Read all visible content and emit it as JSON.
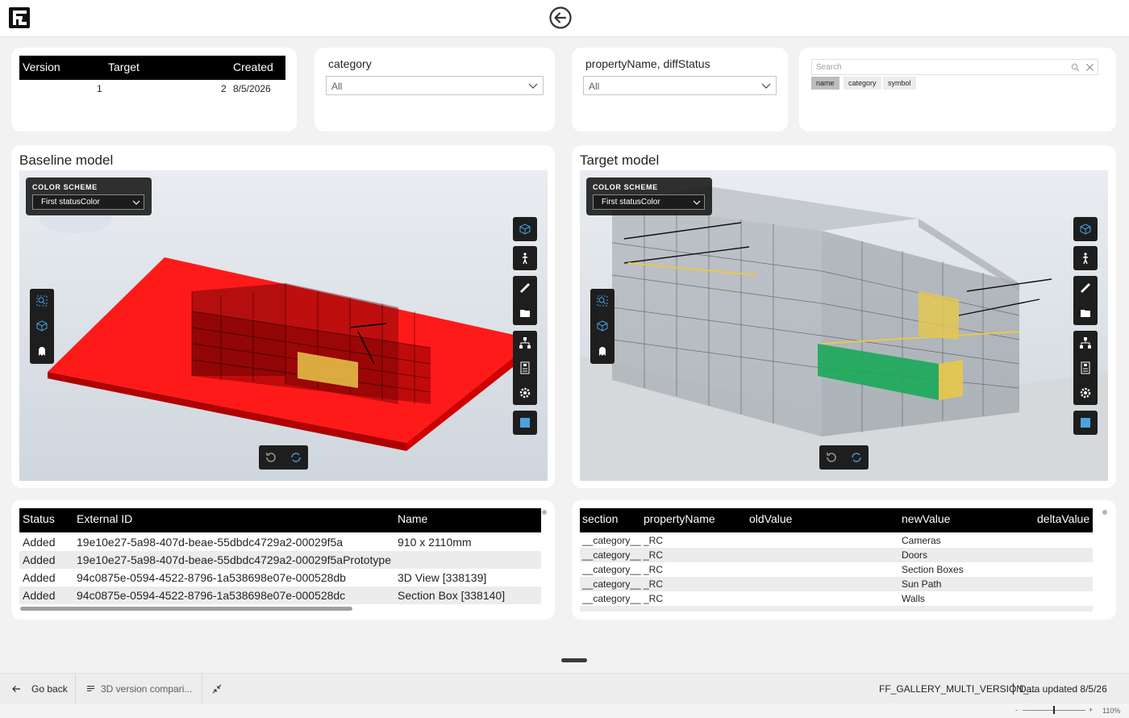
{
  "header": {
    "logo_icon": "flowfuse-logo",
    "back_icon": "circle-arrow-left-icon"
  },
  "version_table": {
    "columns": [
      "Version",
      "Target",
      "Created"
    ],
    "rows": [
      {
        "version": "1",
        "target": "2",
        "created": "8/5/2026"
      }
    ]
  },
  "category_slicer": {
    "title": "category",
    "value": "All"
  },
  "property_slicer": {
    "title": "propertyName, diffStatus",
    "value": "All"
  },
  "search_slicer": {
    "placeholder": "Search",
    "chips": [
      {
        "label": "name",
        "active": true
      },
      {
        "label": "category",
        "active": false
      },
      {
        "label": "symbol",
        "active": false
      }
    ]
  },
  "baseline": {
    "title": "Baseline model",
    "color_scheme_label": "COLOR SCHEME",
    "color_scheme_value": "First statusColor",
    "highlight_colors": {
      "added": "#ff1a1a",
      "modified": "#e8c84a"
    }
  },
  "target": {
    "title": "Target model",
    "color_scheme_label": "COLOR SCHEME",
    "color_scheme_value": "First statusColor",
    "highlight_colors": {
      "modified": "#e8c84a",
      "changed": "#1aa85a"
    }
  },
  "viewer_tools": {
    "right": [
      "cube-view-icon",
      "walk-person-icon",
      "measure-ruler-icon",
      "folder-icon",
      "model-tree-icon",
      "properties-icon",
      "settings-gear-icon",
      "fullscreen-icon"
    ],
    "left": [
      "zoom-fit-icon",
      "orbit-cube-icon",
      "ghost-icon"
    ],
    "bottom": [
      "reset-view-icon",
      "sync-views-icon"
    ]
  },
  "elements_table": {
    "columns": [
      "Status",
      "External ID",
      "Name"
    ],
    "rows": [
      {
        "status": "Added",
        "external_id": "19e10e27-5a98-407d-beae-55dbdc4729a2-00029f5a",
        "name": "910 x 2110mm"
      },
      {
        "status": "Added",
        "external_id": "19e10e27-5a98-407d-beae-55dbdc4729a2-00029f5aPrototype",
        "name": ""
      },
      {
        "status": "Added",
        "external_id": "94c0875e-0594-4522-8796-1a538698e07e-000528db",
        "name": "3D View [338139]"
      },
      {
        "status": "Added",
        "external_id": "94c0875e-0594-4522-8796-1a538698e07e-000528dc",
        "name": "Section Box [338140]"
      }
    ]
  },
  "diff_table": {
    "columns": [
      "section",
      "propertyName",
      "oldValue",
      "newValue",
      "deltaValue"
    ],
    "rows": [
      {
        "section": "__category__",
        "property": "_RC",
        "old": "",
        "new": "Cameras",
        "delta": ""
      },
      {
        "section": "__category__",
        "property": "_RC",
        "old": "",
        "new": "Doors",
        "delta": ""
      },
      {
        "section": "__category__",
        "property": "_RC",
        "old": "",
        "new": "Section Boxes",
        "delta": ""
      },
      {
        "section": "__category__",
        "property": "_RC",
        "old": "",
        "new": "Sun Path",
        "delta": ""
      },
      {
        "section": "__category__",
        "property": "_RC",
        "old": "",
        "new": "Walls",
        "delta": ""
      }
    ]
  },
  "bottom_bar": {
    "go_back": "Go back",
    "page_selector": "3D version compari...",
    "report_name": "FF_GALLERY_MULTI_VERSION_...",
    "data_updated": "Data updated 8/5/26"
  },
  "status_bar": {
    "zoom": "110%",
    "zoom_minus": "-",
    "zoom_plus": "+",
    "zoom_fraction": 0.5
  }
}
